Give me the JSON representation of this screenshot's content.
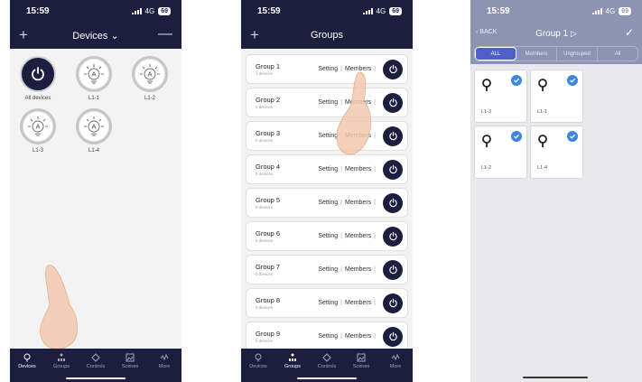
{
  "status": {
    "time": "15:59",
    "network": "4G",
    "battery": "69"
  },
  "devices_screen": {
    "title": "Devices",
    "devices": [
      {
        "label": "All devices",
        "kind": "power"
      },
      {
        "label": "L1-1",
        "kind": "light"
      },
      {
        "label": "L1-2",
        "kind": "light"
      },
      {
        "label": "L1-3",
        "kind": "light"
      },
      {
        "label": "L1-4",
        "kind": "light"
      }
    ],
    "bulb_glyph": "A"
  },
  "tabs": [
    "Devices",
    "Groups",
    "Controls",
    "Scenes",
    "More"
  ],
  "groups_screen": {
    "title": "Groups",
    "setting_label": "Setting",
    "members_label": "Members",
    "groups": [
      {
        "name": "Group 1",
        "sub": "4 devices"
      },
      {
        "name": "Group 2",
        "sub": "0 devices"
      },
      {
        "name": "Group 3",
        "sub": "0 devices"
      },
      {
        "name": "Group 4",
        "sub": "0 devices"
      },
      {
        "name": "Group 5",
        "sub": "0 devices"
      },
      {
        "name": "Group 6",
        "sub": "0 devices"
      },
      {
        "name": "Group 7",
        "sub": "0 devices"
      },
      {
        "name": "Group 8",
        "sub": "0 devices"
      },
      {
        "name": "Group 9",
        "sub": "0 devices"
      }
    ]
  },
  "members_screen": {
    "back_label": "BACK",
    "title": "Group 1",
    "segments": [
      "ALL",
      "Members",
      "Ungrouped",
      "All"
    ],
    "members": [
      "L1-3",
      "L1-1",
      "L1-2",
      "L1-4"
    ]
  },
  "colors": {
    "navy": "#1b1e3f",
    "check_blue": "#3d86dd",
    "dim_overlay": "#8d93b3"
  }
}
